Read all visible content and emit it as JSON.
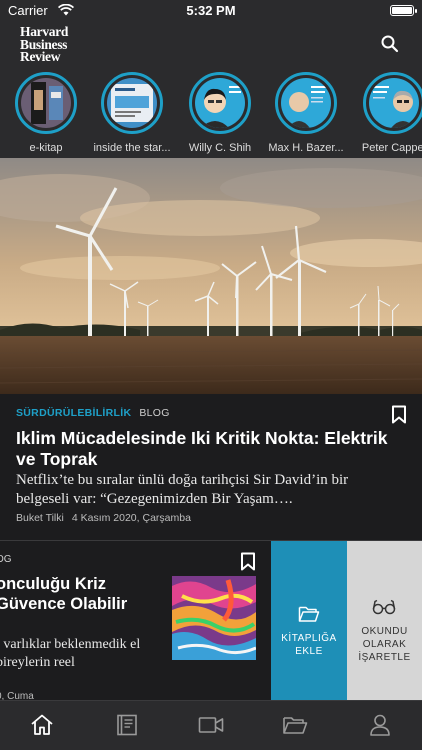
{
  "status": {
    "carrier": "Carrier",
    "time": "5:32 PM"
  },
  "header": {
    "logo_line1": "Harvard",
    "logo_line2": "Business",
    "logo_line3": "Review"
  },
  "stories": [
    {
      "label": "e-kitap",
      "icon": "book-cover"
    },
    {
      "label": "inside the star...",
      "icon": "magazine-cover"
    },
    {
      "label": "Willy C. Shih",
      "icon": "author-portrait"
    },
    {
      "label": "Max H. Bazer...",
      "icon": "author-portrait"
    },
    {
      "label": "Peter Cappel",
      "icon": "author-portrait"
    }
  ],
  "featured": {
    "category": "SÜRDÜRÜLEBİLİRLİK",
    "type": "BLOG",
    "title": "Iklim Mücadelesinde Iki Kritik Nokta: Elektrik ve Toprak",
    "summary": "Netflix’te bu sıralar ünlü doğa tarihçisi Sir David’in bir belgeseli var: “Gezegenimizden Bir Yaşam….",
    "author": "Buket Tilki",
    "date": "4 Kasım 2020, Çarşamba"
  },
  "second": {
    "type": "OG",
    "title": "onculuğu Kriz Güvence Olabilir",
    "summary": "l varlıklar beklenmedik el bireylerin reel",
    "date": "0, Cuma"
  },
  "swipe_actions": {
    "library_line1": "KİTAPLIĞA",
    "library_line2": "EKLE",
    "read_line1": "OKUNDU",
    "read_line2": "OLARAK",
    "read_line3": "İŞARETLE"
  },
  "tabs": [
    "home-icon",
    "book-icon",
    "video-icon",
    "folder-icon",
    "profile-icon"
  ],
  "colors": {
    "accent": "#1ea0c8",
    "library_bg": "#1e8fb7",
    "read_bg": "#d6d6d6",
    "bar_bg": "#2b2b2d"
  }
}
